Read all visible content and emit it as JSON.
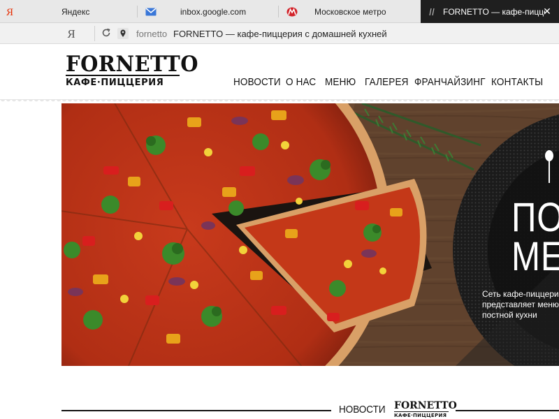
{
  "browser": {
    "tabs": [
      {
        "label": "Яндекс",
        "icon": "yandex-icon"
      },
      {
        "label": "inbox.google.com",
        "icon": "mail-icon"
      },
      {
        "label": "Московское метро",
        "icon": "metro-icon"
      },
      {
        "label": "FORNETTO — кафе-пиццерия с...",
        "icon": "fornetto-favicon",
        "active": true
      }
    ],
    "address": {
      "yandex_button": "Я",
      "domain": "fornetto",
      "title": "FORNETTO — кафе-пиццерия с домашней кухней"
    },
    "colors": {
      "active_tab": "#1f1f1f",
      "yandex_red": "#e62e04",
      "mail_blue": "#3a77d8",
      "metro_red": "#d2232a"
    }
  },
  "site": {
    "logo": {
      "main": "FORNETTO",
      "sub": "КАФЕ·ПИЦЦЕРИЯ"
    },
    "nav": [
      "НОВОСТИ",
      "О НАС",
      "МЕНЮ",
      "ГАЛЕРЕЯ",
      "ФРАНЧАЙЗИНГ",
      "КОНТАКТЫ"
    ],
    "hero": {
      "title_line1": "ПОС",
      "title_line2": "МЕН",
      "description": "Сеть кафе-пиццерий представляет меню постной кухни",
      "icon": "spoon-icon"
    },
    "news_section": {
      "label": "НОВОСТИ",
      "logo_main": "FORNETTO",
      "logo_sub": "КАФЕ·ПИЦЦЕРИЯ"
    }
  }
}
